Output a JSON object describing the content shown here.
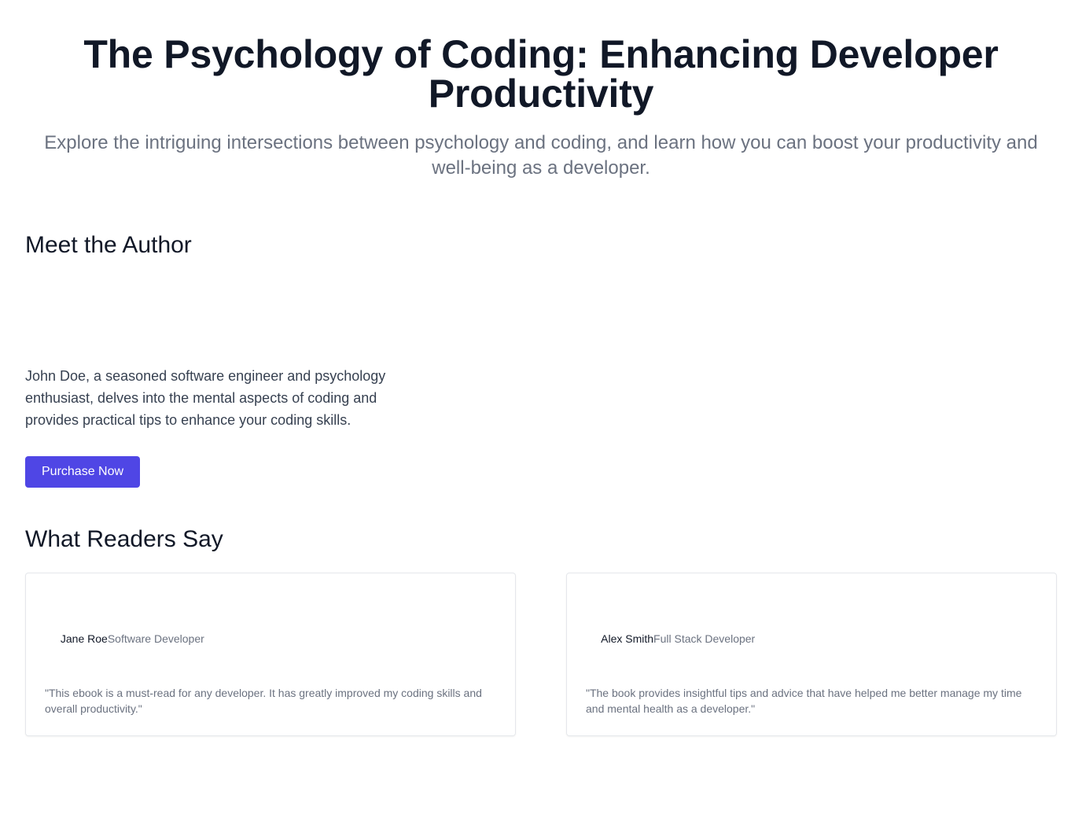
{
  "hero": {
    "title": "The Psychology of Coding: Enhancing Developer Productivity",
    "subtitle": "Explore the intriguing intersections between psychology and coding, and learn how you can boost your productivity and well-being as a developer."
  },
  "author": {
    "heading": "Meet the Author",
    "bio": "John Doe, a seasoned software engineer and psychology enthusiast, delves into the mental aspects of coding and provides practical tips to enhance your coding skills.",
    "purchase_label": "Purchase Now"
  },
  "testimonials": {
    "heading": "What Readers Say",
    "items": [
      {
        "name": "Jane Roe",
        "role": "Software Developer",
        "quote": "\"This ebook is a must-read for any developer. It has greatly improved my coding skills and overall productivity.\""
      },
      {
        "name": "Alex Smith",
        "role": "Full Stack Developer",
        "quote": "\"The book provides insightful tips and advice that have helped me better manage my time and mental health as a developer.\""
      }
    ]
  },
  "colors": {
    "accent": "#4f46e5",
    "heading": "#111827",
    "muted": "#6b7280",
    "body": "#374151",
    "card_border": "#e5e7eb"
  }
}
